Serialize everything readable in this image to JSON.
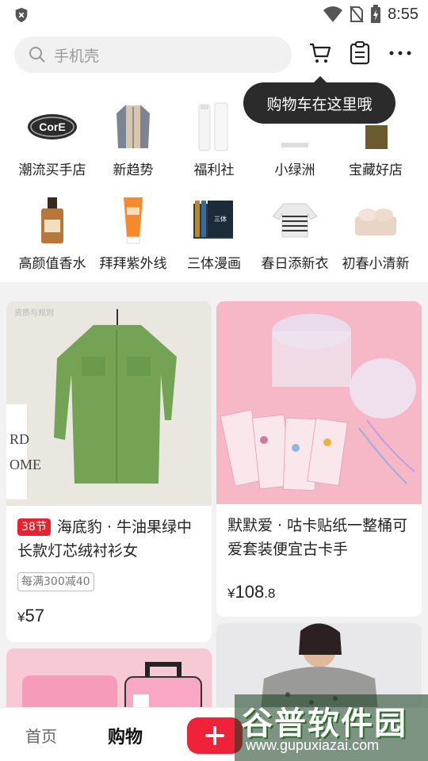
{
  "status_bar": {
    "time": "8:55"
  },
  "search": {
    "placeholder": "手机壳"
  },
  "tooltip": {
    "text": "购物车在这里哦"
  },
  "categories": [
    {
      "label": "潮流买手店",
      "icon": "core-brand-logo"
    },
    {
      "label": "新趋势",
      "icon": "jacket-image"
    },
    {
      "label": "福利社",
      "icon": "skincare-bottles-image"
    },
    {
      "label": "小绿洲",
      "icon": "lamp-image"
    },
    {
      "label": "宝藏好店",
      "icon": "clothing-image"
    },
    {
      "label": "高颜值香水",
      "icon": "perfume-image"
    },
    {
      "label": "拜拜紫外线",
      "icon": "sunscreen-image"
    },
    {
      "label": "三体漫画",
      "icon": "comic-books-image"
    },
    {
      "label": "春日添新衣",
      "icon": "striped-sweater-image"
    },
    {
      "label": "初春小清新",
      "icon": "bedding-image"
    }
  ],
  "feed": [
    {
      "badge": "38节",
      "title": "海底豹 · 牛油果绿中长款灯芯绒衬衫女",
      "coupon": "每满300减40",
      "price_symbol": "¥",
      "price": "57",
      "image": "green-shirt-photo",
      "image_caption": "资质与规则"
    },
    {
      "title": "默默爱 · 咕卡贴纸一整桶可爱套装便宜古卡手",
      "price_symbol": "¥",
      "price_int": "108",
      "price_dec": ".8",
      "image": "sticker-bucket-photo"
    },
    {
      "image": "pink-suitcase-toy-photo"
    },
    {
      "image": "woman-floral-blouse-photo"
    }
  ],
  "bottom_nav": {
    "home": "首页",
    "shop": "购物",
    "plus": "+"
  },
  "watermark": {
    "title": "谷普软件园",
    "url": "www.gupuxiazai.com"
  },
  "colors": {
    "accent": "#f0223a",
    "tooltip_bg": "#2b2b2b",
    "feed_bg": "#f2f2f2"
  }
}
